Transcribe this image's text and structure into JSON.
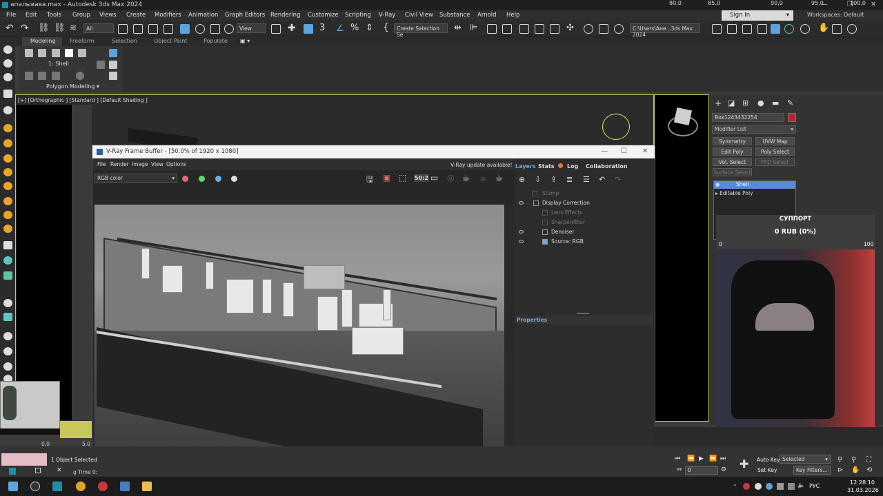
{
  "window": {
    "title": "апалывава.max - Autodesk 3ds Max 2024"
  },
  "menu": [
    "File",
    "Edit",
    "Tools",
    "Group",
    "Views",
    "Create",
    "Modifiers",
    "Animation",
    "Graph Editors",
    "Rendering",
    "Customize",
    "Scripting",
    "V-Ray",
    "Civil View",
    "Substance",
    "Arnold",
    "Help"
  ],
  "signin": {
    "label": "Sign In"
  },
  "workspaces": {
    "label": "Workspaces:",
    "value": "Default"
  },
  "toolbar": {
    "filter_value": "All",
    "view_value": "View",
    "selection_set_placeholder": "Create Selection Se",
    "path_value": "C:\\Users\\Ане...3ds Max 2024"
  },
  "ribbon": {
    "tabs": [
      "Modeling",
      "Freeform",
      "Selection",
      "Object Paint",
      "Populate"
    ],
    "shell_label": "1: Shell",
    "panel_label": "Polygon Modeling"
  },
  "viewport": {
    "label": "[+] [Orthographic ] [Standard ] [Default Shading ]"
  },
  "vfb": {
    "title": "V-Ray Frame Buffer - [50.0% of 1920 x 1080]",
    "menu": [
      "File",
      "Render",
      "Image",
      "View",
      "Options"
    ],
    "update_notice": "V-Ray update available!",
    "channel": "RGB color",
    "zoom_badge": "50:2",
    "layer_tabs": [
      "Layers",
      "Stats",
      "Log",
      "Collaboration"
    ],
    "layers": [
      {
        "label": "Stamp",
        "enabled": false
      },
      {
        "label": "Display Correction",
        "enabled": true
      },
      {
        "label": "Lens Effects",
        "enabled": false
      },
      {
        "label": "Sharpen/Blur",
        "enabled": false
      },
      {
        "label": "Denoiser",
        "enabled": true
      },
      {
        "label": "Source: RGB",
        "enabled": true
      }
    ],
    "properties_label": "Properties"
  },
  "command_panel": {
    "object_name": "Box1243432254",
    "object_color": "#b8242e",
    "modifier_list": "Modifier List",
    "buttons": [
      "Symmetry",
      "UVW Map",
      "Edit Poly",
      "Poly Select",
      "Vol. Select",
      "FFD Select",
      "Surface Select"
    ],
    "stack": [
      "Shell",
      "Editable Poly"
    ]
  },
  "donation_widget": {
    "title": "СУППОРТ",
    "amount": "0 RUB (0%)",
    "min": "0",
    "max": "100"
  },
  "timeline": {
    "ticks": [
      "80,0",
      "85,0",
      "90,0",
      "95,0",
      "100,0"
    ],
    "left_ticks": [
      "0,0",
      "5,0"
    ]
  },
  "status": {
    "selection": "1 Object Selected",
    "time_tag": "g Time",
    "time_value": "0:",
    "auto_key": "Auto Key",
    "set_key": "Set Key",
    "selected_dd": "Selected",
    "key_filters": "Key Filters...",
    "frame": "0"
  },
  "taskbar": {
    "lang": "РУС",
    "time": "12:28:10",
    "date": "31.03.2026"
  }
}
